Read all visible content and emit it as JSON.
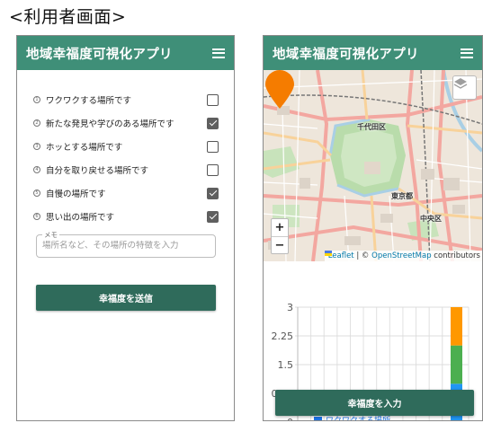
{
  "page_heading": "<利用者画面>",
  "left_phone": {
    "app_title": "地域幸福度可視化アプリ",
    "checklist": [
      {
        "num": "1",
        "label": "ワクワクする場所です",
        "checked": false
      },
      {
        "num": "2",
        "label": "新たな発見や学びのある場所です",
        "checked": true
      },
      {
        "num": "3",
        "label": "ホッとする場所です",
        "checked": false
      },
      {
        "num": "4",
        "label": "自分を取り戻せる場所です",
        "checked": false
      },
      {
        "num": "5",
        "label": "自慢の場所です",
        "checked": true
      },
      {
        "num": "6",
        "label": "思い出の場所です",
        "checked": true
      }
    ],
    "memo": {
      "legend": "メモ",
      "placeholder": "場所名など、その場所の特徴を入力",
      "value": ""
    },
    "submit_label": "幸福度を送信"
  },
  "right_phone": {
    "app_title": "地域幸福度可視化アプリ",
    "map": {
      "labels": {
        "chiyoda": "千代田区",
        "tokyo": "東京都",
        "chuo": "中央区"
      },
      "zoom_in": "+",
      "zoom_out": "−",
      "attribution": {
        "leaflet": "Leaflet",
        "sep": " | © ",
        "osm": "OpenStreetMap",
        "suffix": " contributors"
      },
      "marker_color": "#f57c00"
    },
    "input_label": "幸福度を入力",
    "legend_peek": "ワクワクする場所"
  },
  "chart_data": {
    "type": "bar",
    "stacked": true,
    "ylim": [
      0,
      3
    ],
    "yticks": [
      "0",
      "0.75",
      "1.5",
      "2.25",
      "3"
    ],
    "stack_values": [
      {
        "color": "#2196f3",
        "value": 1.0
      },
      {
        "color": "#4caf50",
        "value": 1.0
      },
      {
        "color": "#ff9800",
        "value": 1.0
      }
    ]
  },
  "colors": {
    "appbar": "#3f8f78",
    "button": "#2f6b5b"
  }
}
